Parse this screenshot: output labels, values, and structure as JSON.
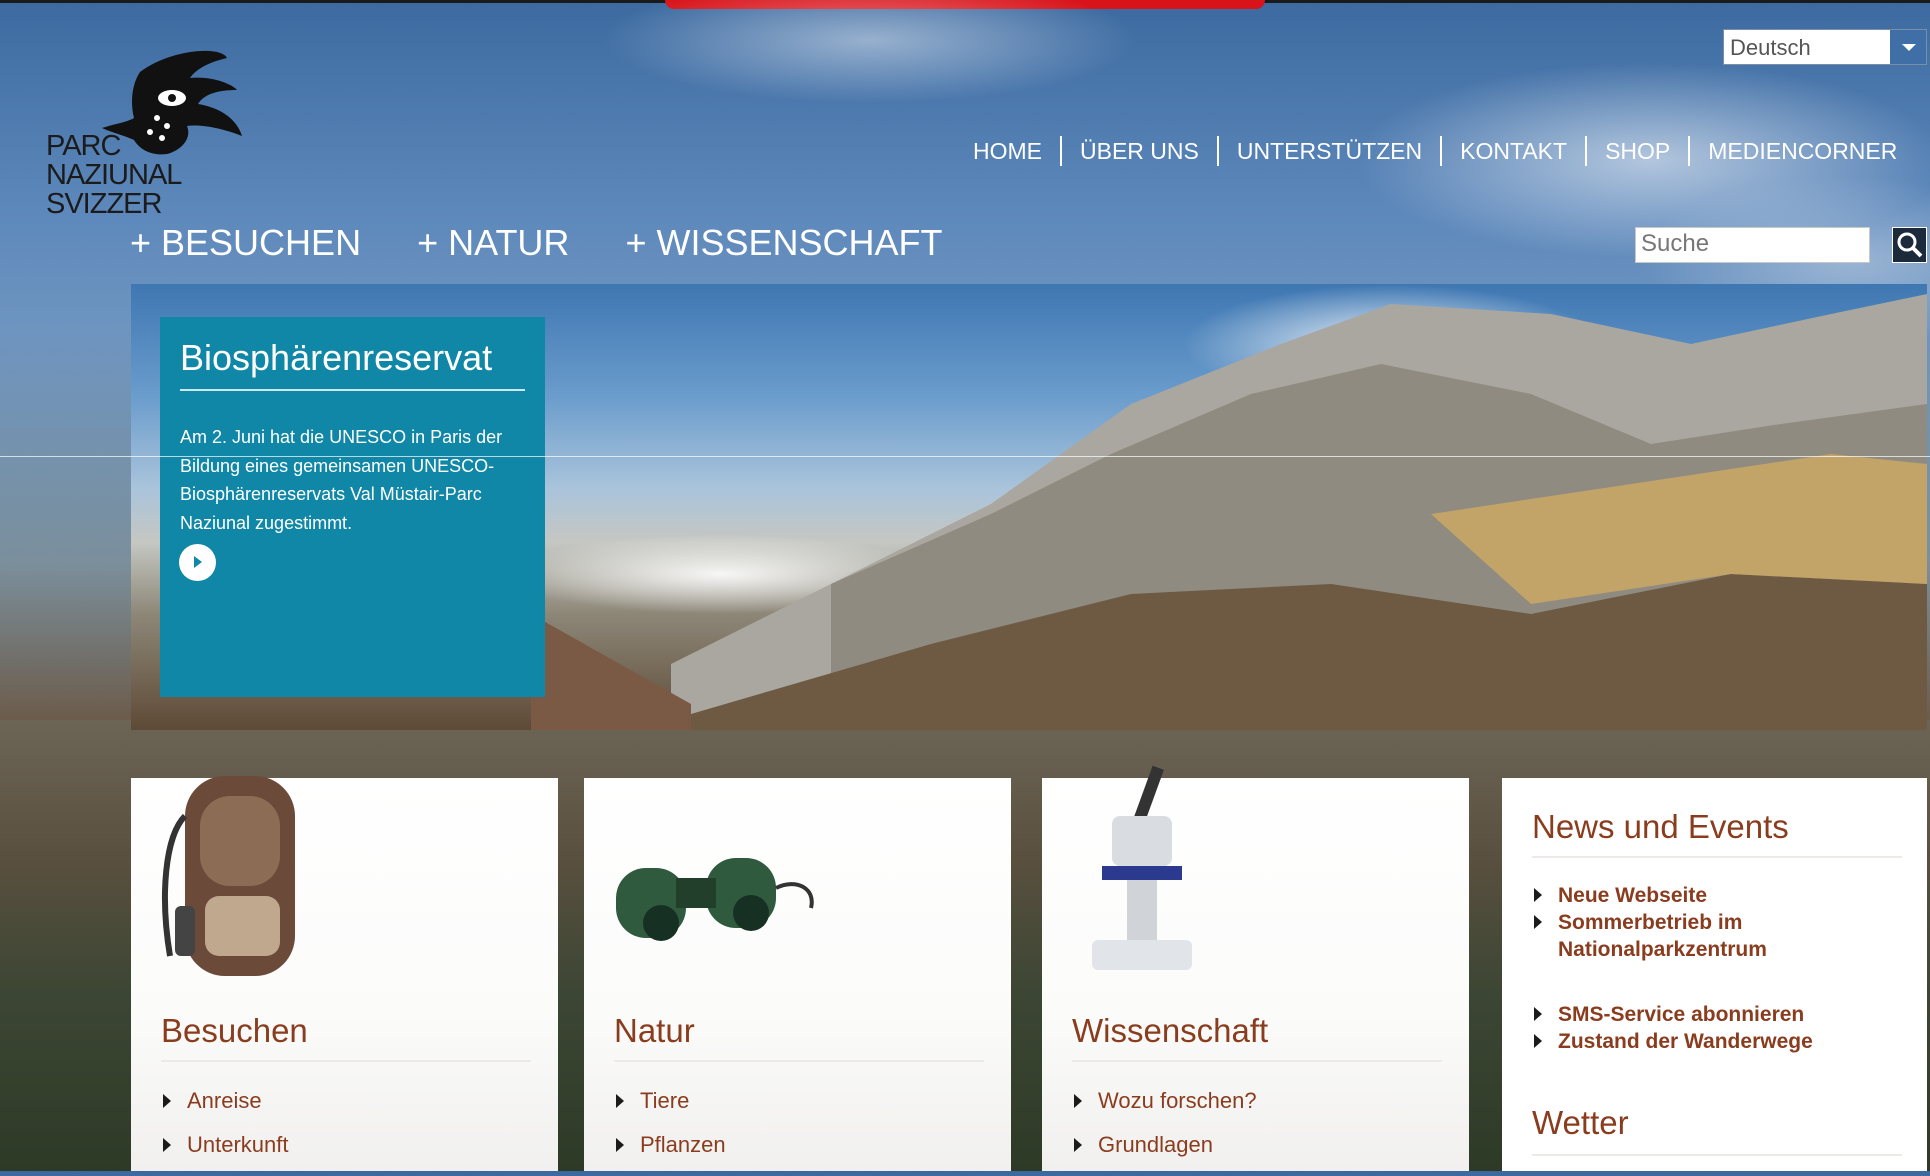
{
  "logo": {
    "line1": "PARC",
    "line2": "NAZIUNAL",
    "line3": "SVIZZER"
  },
  "language": {
    "selected": "Deutsch"
  },
  "top_nav": [
    "HOME",
    "ÜBER UNS",
    "UNTERSTÜTZEN",
    "KONTAKT",
    "SHOP",
    "MEDIENCORNER"
  ],
  "main_nav": [
    "+ BESUCHEN",
    "+ NATUR",
    "+ WISSENSCHAFT"
  ],
  "search": {
    "placeholder": "Suche"
  },
  "hero": {
    "title": "Biosphärenreservat",
    "text": "Am 2. Juni hat die UNESCO in Paris der Bildung eines gemeinsamen UNESCO-Biosphärenreservats Val Müstair-Parc Naziunal zugestimmt."
  },
  "cards": [
    {
      "title": "Besuchen",
      "links": [
        "Anreise",
        "Unterkunft"
      ],
      "image": "backpack"
    },
    {
      "title": "Natur",
      "links": [
        "Tiere",
        "Pflanzen"
      ],
      "image": "binoculars"
    },
    {
      "title": "Wissenschaft",
      "links": [
        "Wozu forschen?",
        "Grundlagen"
      ],
      "image": "microscope"
    }
  ],
  "news": {
    "title": "News und Events",
    "items": [
      "Neue Webseite",
      "Sommerbetrieb im Nationalparkzentrum",
      "SMS-Service abonnieren",
      "Zustand der Wanderwege"
    ],
    "weather_title": "Wetter"
  },
  "colors": {
    "accent_teal": "#1087a6",
    "heading_brown": "#8a3d1e",
    "brand_red": "#d8131a"
  }
}
